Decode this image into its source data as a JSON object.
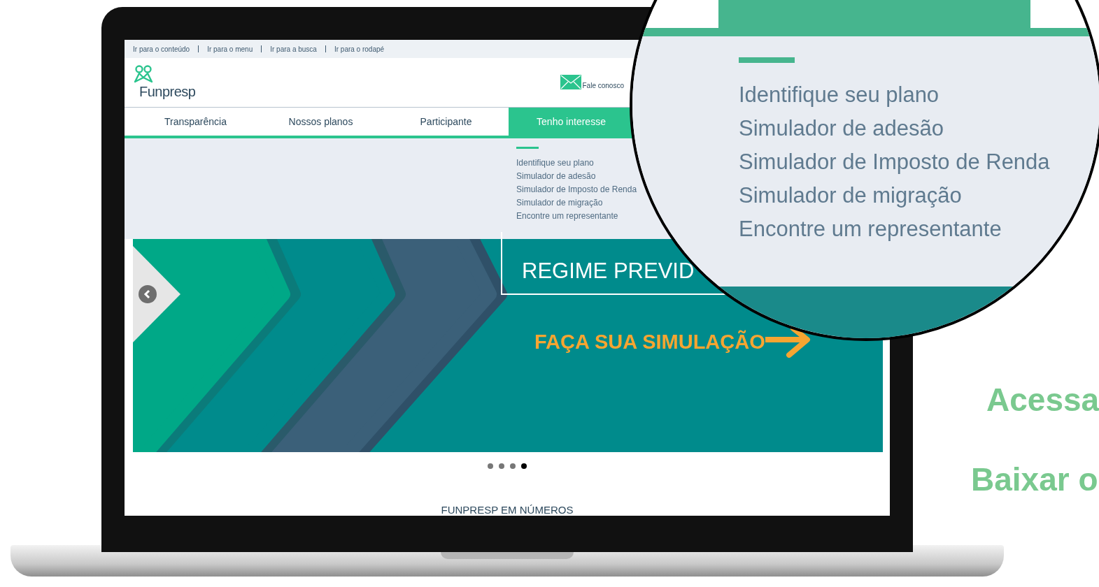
{
  "skip_links": [
    "Ir para o conteúdo",
    "Ir para o menu",
    "Ir para a busca",
    "Ir para o rodapé"
  ],
  "header": {
    "logo_text": "Funpresp",
    "contact_label": "Fale conosco"
  },
  "nav": [
    {
      "label": "Transparência",
      "selected": false
    },
    {
      "label": "Nossos planos",
      "selected": false
    },
    {
      "label": "Participante",
      "selected": false
    },
    {
      "label": "Tenho interesse",
      "selected": true
    }
  ],
  "dropdown": [
    "Identifique seu plano",
    "Simulador de adesão",
    "Simulador de Imposto de Renda",
    "Simulador de migração",
    "Encontre um representante"
  ],
  "hero": {
    "headline": "REGIME PREVID",
    "cta": "FAÇA SUA SIMULAÇÃO"
  },
  "slides": [
    {
      "selected": false
    },
    {
      "selected": false
    },
    {
      "selected": false
    },
    {
      "selected": true
    }
  ],
  "section_title": "FUNPRESP EM NÚMEROS",
  "magnifier": {
    "items": [
      "Identifique seu plano",
      "Simulador de adesão",
      "Simulador de Imposto de Renda",
      "Simulador de migração",
      "Encontre um representante"
    ]
  },
  "side_texts": [
    "Acessa",
    "Baixar o"
  ]
}
